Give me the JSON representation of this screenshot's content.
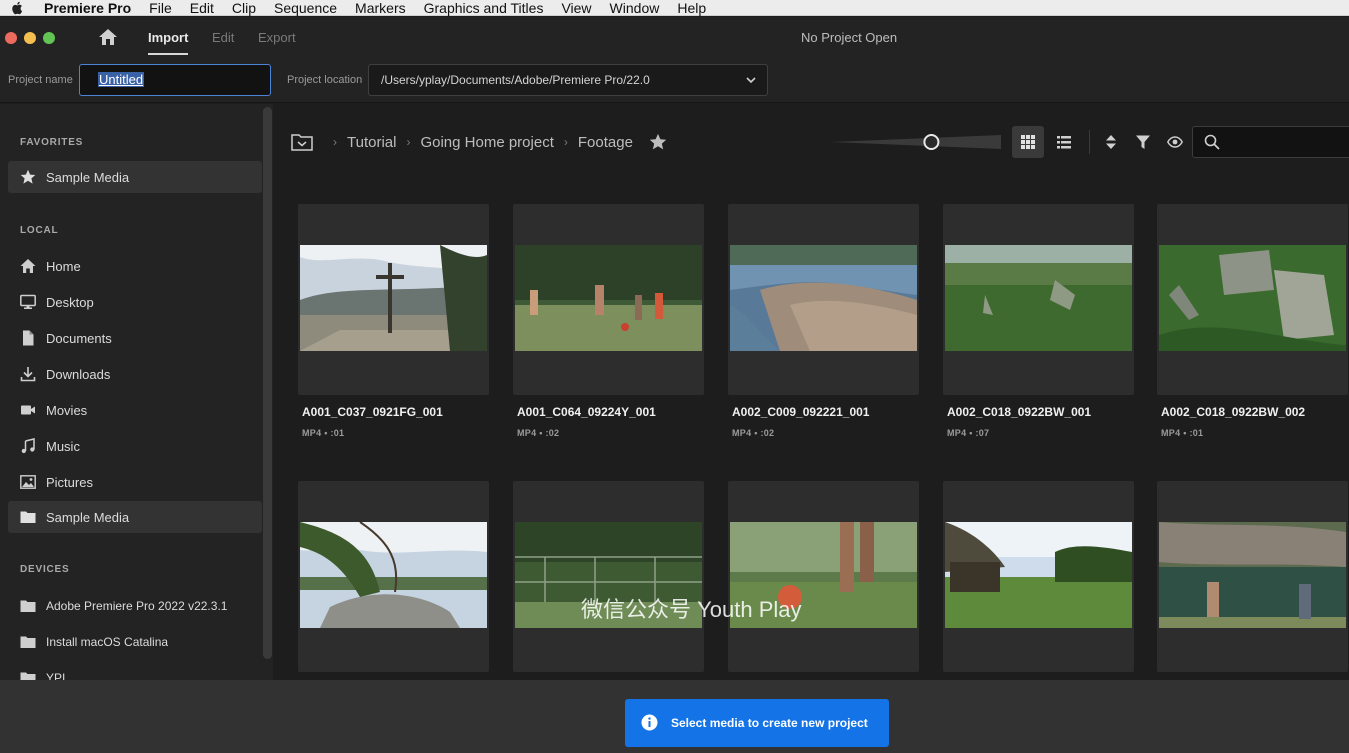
{
  "menubar": {
    "app_name": "Premiere Pro",
    "items": [
      "File",
      "Edit",
      "Clip",
      "Sequence",
      "Markers",
      "Graphics and Titles",
      "View",
      "Window",
      "Help"
    ]
  },
  "header": {
    "tabs": [
      "Import",
      "Edit",
      "Export"
    ],
    "active_tab": "Import",
    "window_title": "No Project Open"
  },
  "project": {
    "name_label": "Project name",
    "name_value": "Untitled",
    "location_label": "Project location",
    "location_value": "/Users/yplay/Documents/Adobe/Premiere Pro/22.0"
  },
  "sidebar": {
    "favorites_head": "FAVORITES",
    "favorites": [
      {
        "label": "Sample Media",
        "icon": "star-icon"
      }
    ],
    "local_head": "LOCAL",
    "local": [
      {
        "label": "Home",
        "icon": "home-icon"
      },
      {
        "label": "Desktop",
        "icon": "desktop-icon"
      },
      {
        "label": "Documents",
        "icon": "document-icon"
      },
      {
        "label": "Downloads",
        "icon": "download-icon"
      },
      {
        "label": "Movies",
        "icon": "movie-camera-icon"
      },
      {
        "label": "Music",
        "icon": "music-note-icon"
      },
      {
        "label": "Pictures",
        "icon": "picture-icon"
      },
      {
        "label": "Sample Media",
        "icon": "folder-icon"
      }
    ],
    "devices_head": "DEVICES",
    "devices": [
      {
        "label": "Adobe Premiere Pro 2022 v22.3.1",
        "icon": "folder-icon"
      },
      {
        "label": "Install macOS Catalina",
        "icon": "folder-icon"
      },
      {
        "label": "YPI",
        "icon": "folder-icon"
      }
    ]
  },
  "browser": {
    "breadcrumb": [
      "Tutorial",
      "Going Home project",
      "Footage"
    ],
    "thumbnail_size": 0.6,
    "clips_row1": [
      {
        "name": "A001_C037_0921FG_001",
        "info": "MP4 • :01"
      },
      {
        "name": "A001_C064_09224Y_001",
        "info": "MP4 • :02"
      },
      {
        "name": "A002_C009_092221_001",
        "info": "MP4 • :02"
      },
      {
        "name": "A002_C018_0922BW_001",
        "info": "MP4 • :07"
      },
      {
        "name": "A002_C018_0922BW_002",
        "info": "MP4 • :01"
      }
    ]
  },
  "watermark": "微信公众号 Youth Play",
  "footer": {
    "create_label": "Select media to create new project"
  },
  "colors": {
    "accent": "#1473e6",
    "input_focus": "#4c83d5"
  }
}
